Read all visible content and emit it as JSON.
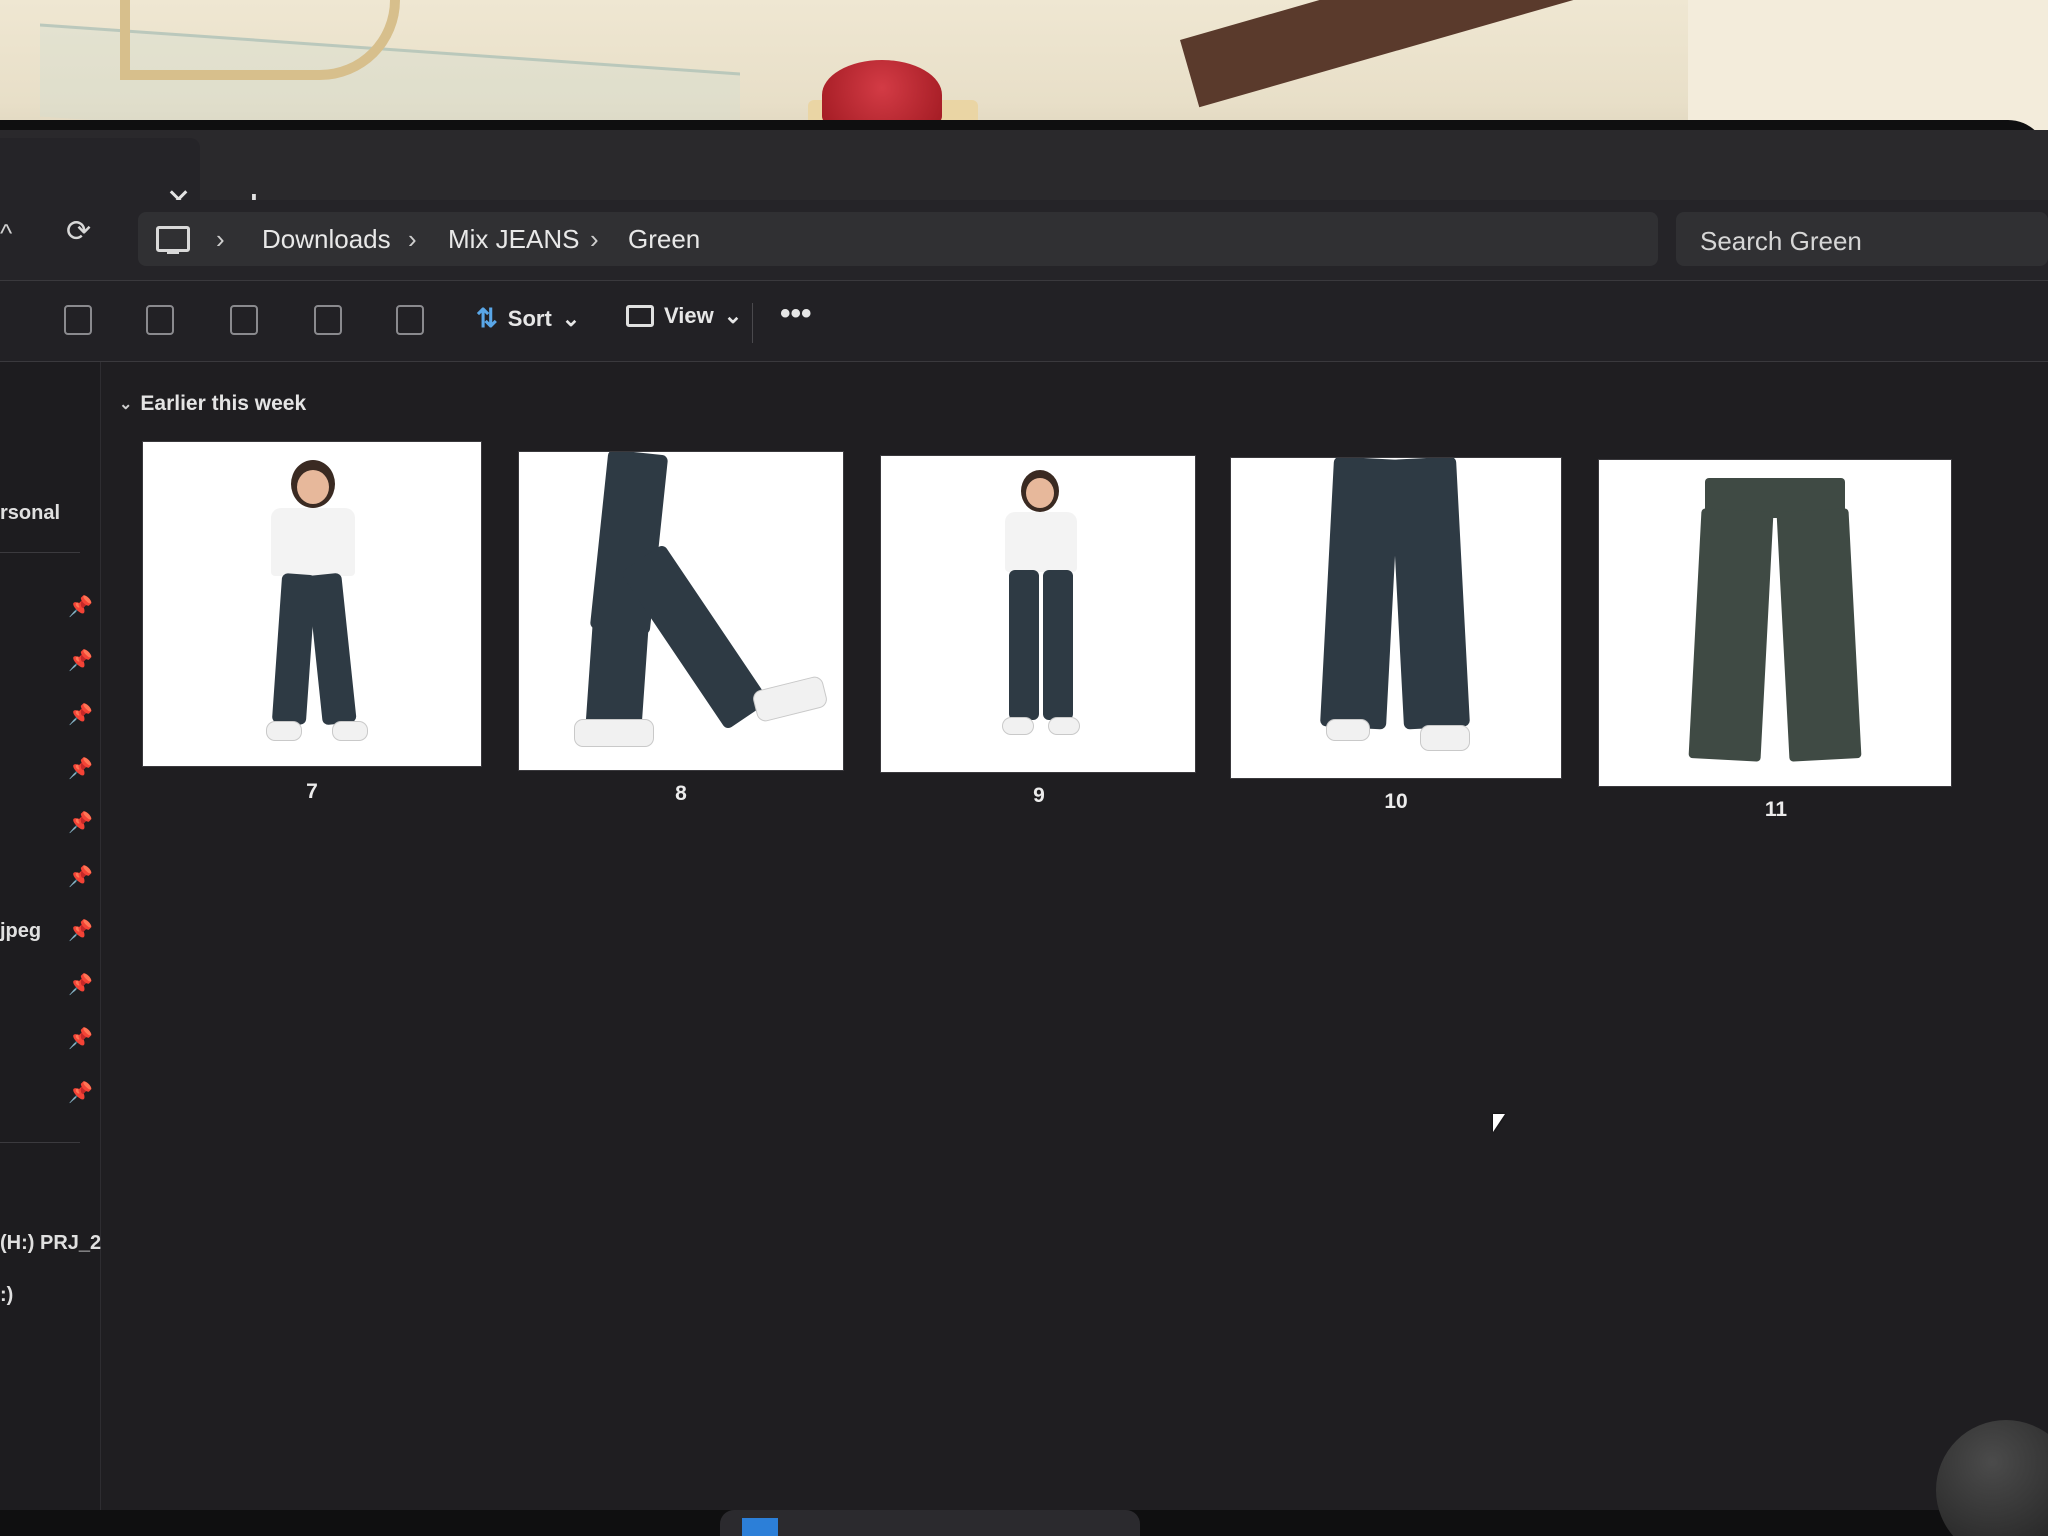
{
  "tabs": {
    "close_glyph": "✕",
    "add_glyph": "+"
  },
  "toolbar": {
    "up_glyph": "^",
    "refresh_glyph": "⟳"
  },
  "breadcrumb": {
    "items": [
      "Downloads",
      "Mix JEANS",
      "Green"
    ],
    "separator": "›"
  },
  "search": {
    "placeholder": "Search Green"
  },
  "commands": {
    "sort_label": "Sort",
    "view_label": "View",
    "more_glyph": "•••",
    "dropdown_glyph": "⌄"
  },
  "nav": {
    "labels": [
      "rsonal",
      "jpeg",
      "(H:) PRJ_2",
      ":)"
    ],
    "pin_glyph": "📌"
  },
  "content": {
    "group_title": "Earlier this week",
    "group_chevron": "⌄",
    "files": [
      {
        "name": "7"
      },
      {
        "name": "8"
      },
      {
        "name": "9"
      },
      {
        "name": "10"
      },
      {
        "name": "11"
      }
    ]
  },
  "colors": {
    "accent": "#5aa7e8",
    "background": "#1f1e21",
    "text": "#e6e6e6"
  }
}
